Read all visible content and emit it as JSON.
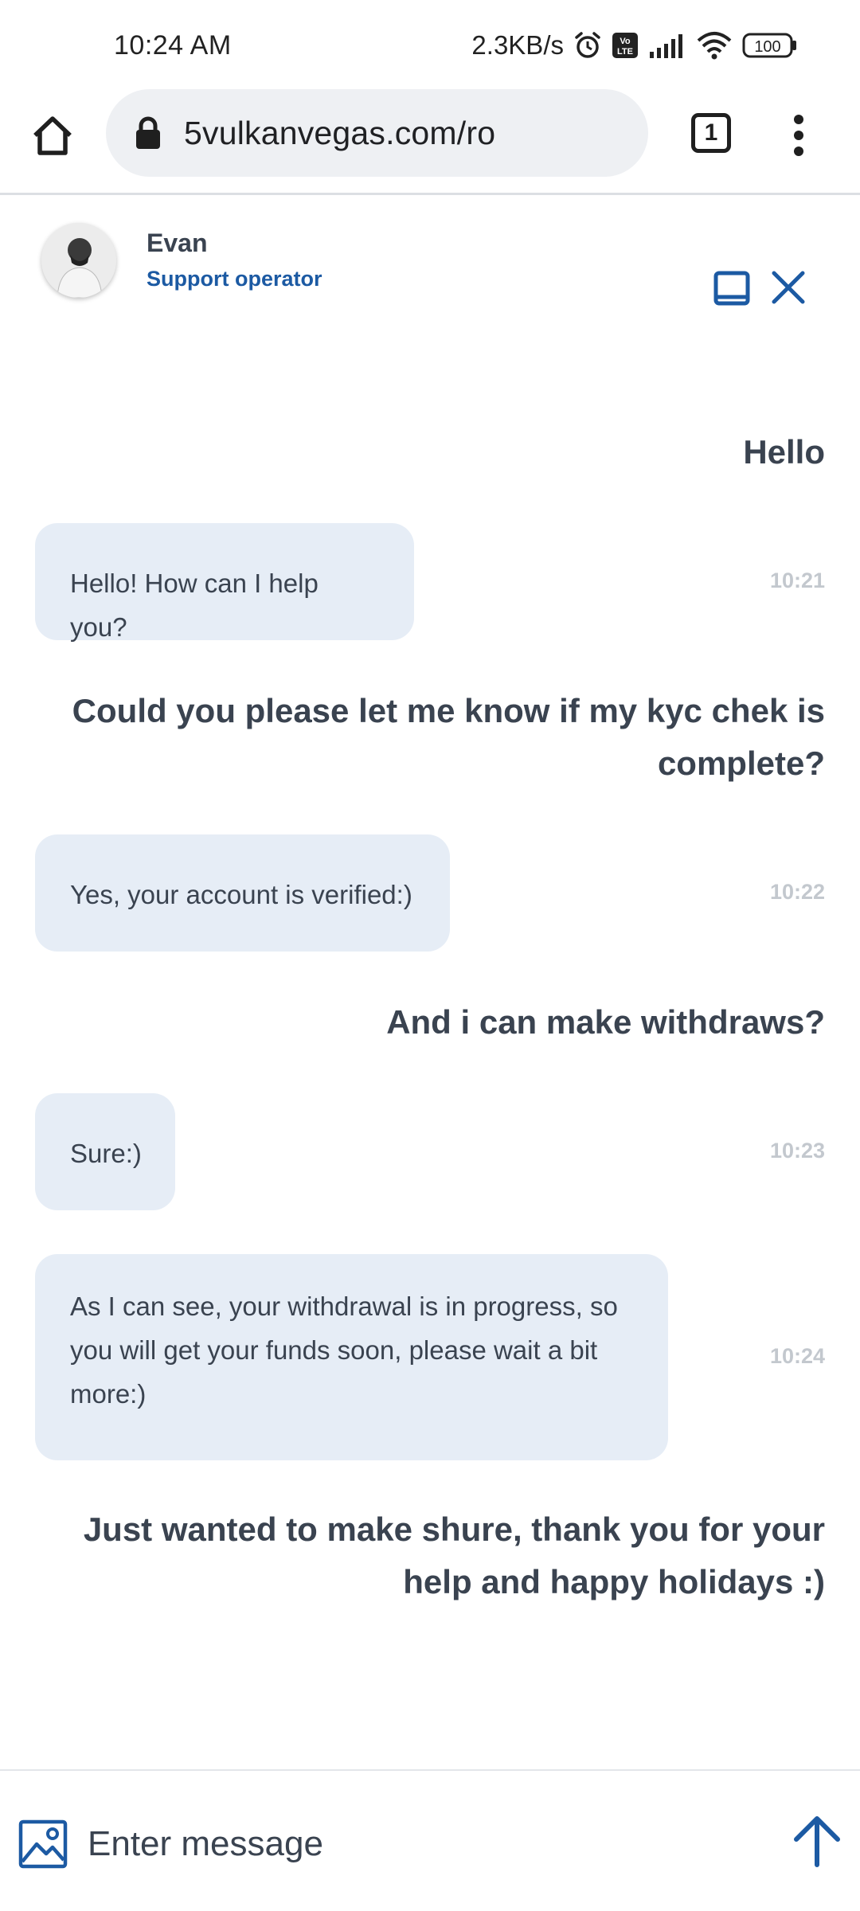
{
  "status_bar": {
    "time": "10:24 AM",
    "net_speed": "2.3KB/s",
    "volte": "Vo LTE",
    "battery": "100"
  },
  "browser": {
    "url": "5vulkanvegas.com/ro",
    "tab_count": "1"
  },
  "chat_header": {
    "agent_name": "Evan",
    "agent_role": "Support operator"
  },
  "messages": [
    {
      "from": "user",
      "text": "Hello"
    },
    {
      "from": "operator",
      "text": "Hello! How can I help you?",
      "time": "10:21"
    },
    {
      "from": "user",
      "text": "Could you please let me know if my kyc chek is complete?"
    },
    {
      "from": "operator",
      "text": "Yes, your account is verified:)",
      "time": "10:22"
    },
    {
      "from": "user",
      "text": "And i can make withdraws?"
    },
    {
      "from": "operator",
      "text": "Sure:)",
      "time": "10:23"
    },
    {
      "from": "operator",
      "text": "As I can see, your withdrawal is in progress, so you will get your funds soon, please wait a bit more:)",
      "time": "10:24"
    },
    {
      "from": "user",
      "text": "Just wanted to make shure, thank you for your help and happy holidays :)"
    }
  ],
  "composer": {
    "placeholder": "Enter message"
  },
  "colors": {
    "accent": "#1c5aa3",
    "operator_bubble": "#e6edf6",
    "text": "#3a4350",
    "timestamp": "#c3c8ce"
  }
}
